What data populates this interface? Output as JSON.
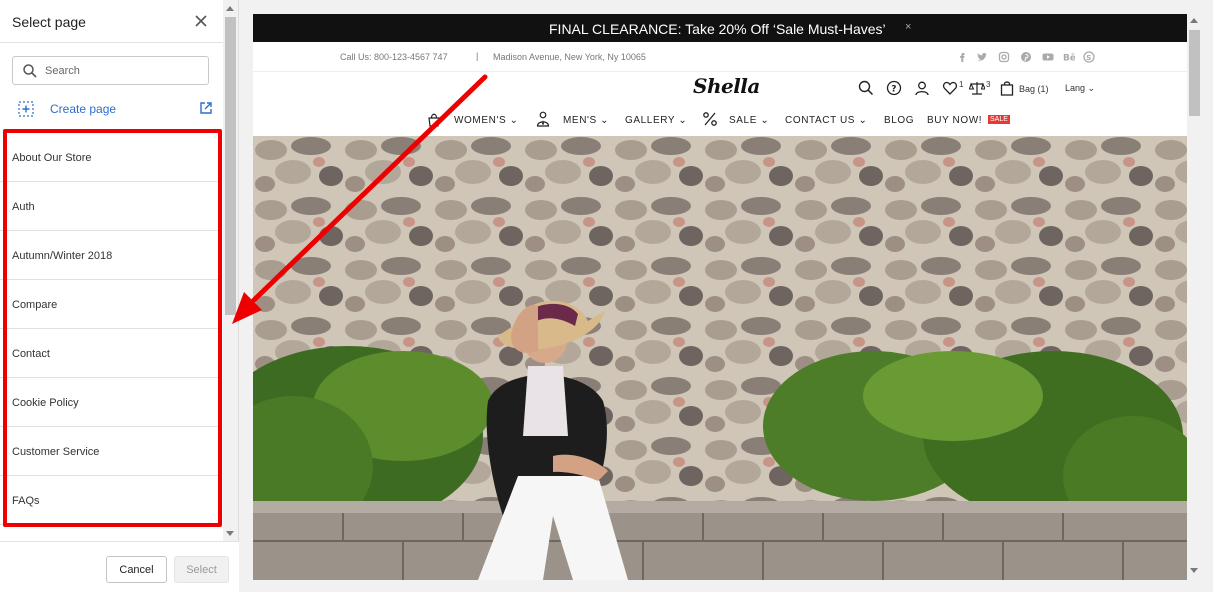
{
  "dialog": {
    "title": "Select page",
    "search_placeholder": "Search",
    "create_page_label": "Create page",
    "pages": [
      "About Our Store",
      "Auth",
      "Autumn/Winter 2018",
      "Compare",
      "Contact",
      "Cookie Policy",
      "Customer Service",
      "FAQs"
    ],
    "cancel_label": "Cancel",
    "select_label": "Select"
  },
  "store": {
    "promo_text": "FINAL CLEARANCE: Take 20% Off ‘Sale Must-Haves’",
    "promo_close": "×",
    "call_text": "Call Us: 800-123-4567 747",
    "separator": "|",
    "address": "Madison Avenue, New York, Ny 10065",
    "social_icons": [
      "facebook-icon",
      "twitter-icon",
      "instagram-icon",
      "pinterest-icon",
      "youtube-icon",
      "behance-icon",
      "skype-icon"
    ],
    "logo": "Shella",
    "wishlist_count": "1",
    "compare_count": "3",
    "bag_label": "Bag (1)",
    "lang_label": "Lang ⌄",
    "nav": {
      "womens": "WOMEN'S ⌄",
      "mens": "MEN'S ⌄",
      "gallery": "GALLERY ⌄",
      "sale": "SALE ⌄",
      "contact": "CONTACT US ⌄",
      "blog": "BLOG",
      "buy_now": "BUY NOW!",
      "sale_badge": "SALE"
    }
  },
  "colors": {
    "accent_link": "#2c6ecb",
    "annotation_red": "#ee0000",
    "promo_bg": "#111111",
    "sale_badge": "#e53935"
  }
}
